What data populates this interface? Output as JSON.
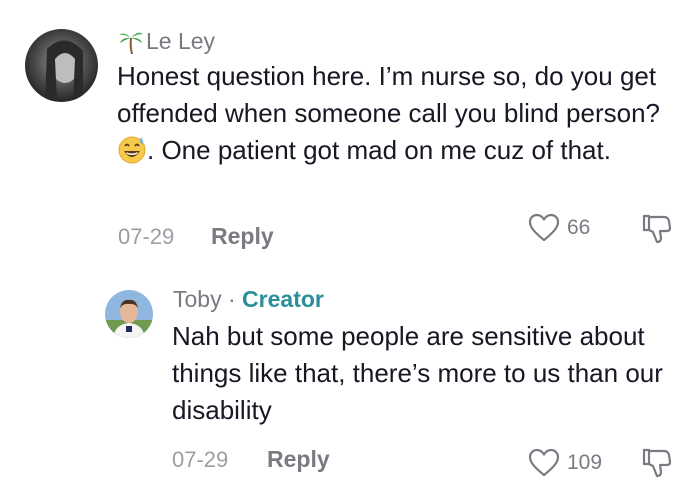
{
  "comment": {
    "username": "Le Ley",
    "username_icon": "palm-tree-icon",
    "text_before_emoji": "Honest question here. I’m nurse so, do you get offended when someone call you blind person?",
    "emoji": "grinning-sweat-emoji",
    "text_after_emoji": ". One patient got mad on me cuz of that.",
    "date": "07-29",
    "reply_label": "Reply",
    "like_count": "66"
  },
  "reply": {
    "username": "Toby",
    "separator": "·",
    "badge": "Creator",
    "text": "Nah but some people are sensitive about things like that, there’s more to us than our disability",
    "date": "07-29",
    "reply_label": "Reply",
    "like_count": "109"
  },
  "colors": {
    "creator_badge": "#2a8f99",
    "muted_text": "#7a7b82",
    "body_text": "#161823"
  }
}
